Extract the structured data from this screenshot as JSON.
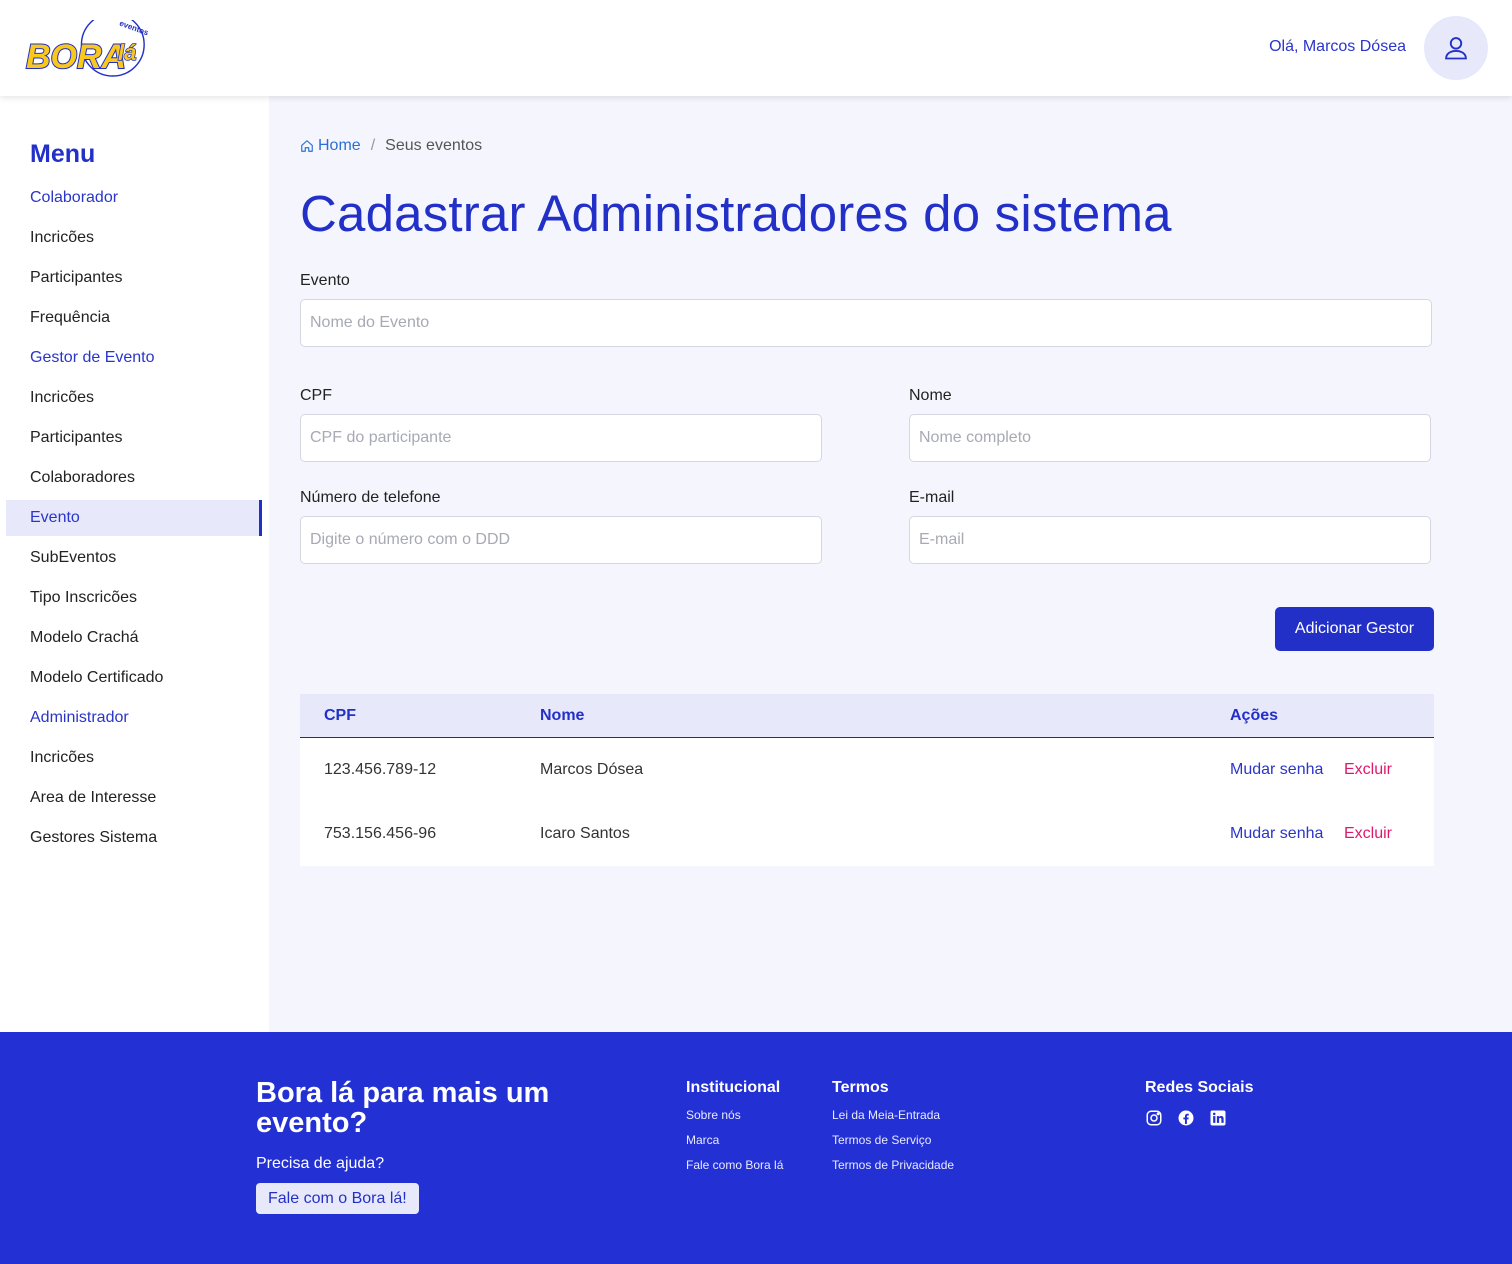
{
  "header": {
    "logo_text": "BORAlá",
    "logo_sub": "eventos",
    "greeting": "Olá, Marcos Dósea"
  },
  "sidebar": {
    "title": "Menu",
    "items": [
      {
        "label": "Colaborador",
        "type": "section"
      },
      {
        "label": "Incricões",
        "type": "item"
      },
      {
        "label": "Participantes",
        "type": "item"
      },
      {
        "label": "Frequência",
        "type": "item"
      },
      {
        "label": "Gestor de Evento",
        "type": "section"
      },
      {
        "label": "Incricões",
        "type": "item"
      },
      {
        "label": "Participantes",
        "type": "item"
      },
      {
        "label": "Colaboradores",
        "type": "item"
      },
      {
        "label": "Evento",
        "type": "active"
      },
      {
        "label": "SubEventos",
        "type": "item"
      },
      {
        "label": "Tipo Inscricões",
        "type": "item"
      },
      {
        "label": "Modelo Crachá",
        "type": "item"
      },
      {
        "label": "Modelo Certificado",
        "type": "item"
      },
      {
        "label": "Administrador",
        "type": "section"
      },
      {
        "label": "Incricões",
        "type": "item"
      },
      {
        "label": "Area de Interesse",
        "type": "item"
      },
      {
        "label": "Gestores Sistema",
        "type": "item"
      }
    ]
  },
  "breadcrumb": {
    "home": "Home",
    "separator": "/",
    "current": "Seus eventos"
  },
  "page_title": "Cadastrar Administradores do sistema",
  "form": {
    "evento_label": "Evento",
    "evento_placeholder": "Nome do Evento",
    "cpf_label": "CPF",
    "cpf_placeholder": "CPF do participante",
    "nome_label": "Nome",
    "nome_placeholder": "Nome completo",
    "telefone_label": "Número de telefone",
    "telefone_placeholder": "Digite o número com o DDD",
    "email_label": "E-mail",
    "email_placeholder": "E-mail",
    "submit_label": "Adicionar Gestor"
  },
  "table": {
    "headers": {
      "cpf": "CPF",
      "nome": "Nome",
      "acoes": "Ações"
    },
    "rows": [
      {
        "cpf": "123.456.789-12",
        "nome": "Marcos Dósea",
        "change": "Mudar senha",
        "delete": "Excluir"
      },
      {
        "cpf": "753.156.456-96",
        "nome": "Icaro Santos",
        "change": "Mudar senha",
        "delete": "Excluir"
      }
    ]
  },
  "footer": {
    "headline": "Bora lá para mais um evento?",
    "help": "Precisa de ajuda?",
    "help_button": "Fale com o Bora lá!",
    "institucional": {
      "title": "Institucional",
      "links": [
        "Sobre nós",
        "Marca",
        "Fale como Bora lá"
      ]
    },
    "termos": {
      "title": "Termos",
      "links": [
        "Lei da Meia-Entrada",
        "Termos de Serviço",
        "Termos de Privacidade"
      ]
    },
    "social": {
      "title": "Redes Sociais",
      "icons": [
        "instagram-icon",
        "facebook-icon",
        "linkedin-icon"
      ]
    }
  },
  "colors": {
    "brand_blue": "#2330c8",
    "footer_blue": "#2330d4",
    "danger": "#e0186c",
    "logo_yellow": "#f8c81c"
  }
}
